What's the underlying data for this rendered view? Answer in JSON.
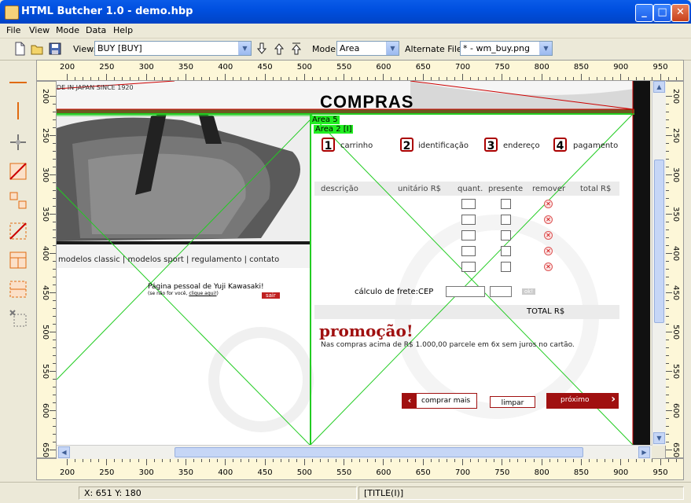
{
  "window": {
    "title": "HTML Butcher 1.0 - demo.hbp"
  },
  "menu": [
    "File",
    "View",
    "Mode",
    "Data",
    "Help"
  ],
  "toolbar": {
    "view_label": "View:",
    "view_value": "BUY [BUY]",
    "mode_label": "Mode:",
    "mode_value": "Area",
    "alt_label": "Alternate File:",
    "alt_value": "* - wm_buy.png"
  },
  "ruler_h_labels": [
    "200",
    "250",
    "300",
    "350",
    "400",
    "450",
    "500",
    "550",
    "600",
    "650",
    "700",
    "750",
    "800",
    "850",
    "900",
    "950"
  ],
  "ruler_v_labels": [
    "200",
    "250",
    "300",
    "350",
    "400",
    "450",
    "500",
    "550",
    "600",
    "650"
  ],
  "page": {
    "made_in": "DE IN JAPAN SINCE 1920",
    "heading": "COMPRAS",
    "area5": "Area 5",
    "area2": "Area 2 [I]",
    "steps": [
      {
        "num": "1",
        "label": "carrinho"
      },
      {
        "num": "2",
        "label": "identificação"
      },
      {
        "num": "3",
        "label": "endereço"
      },
      {
        "num": "4",
        "label": "pagamento"
      }
    ],
    "table_headers": [
      "descrição",
      "unitário R$",
      "quant.",
      "presente",
      "remover",
      "total R$"
    ],
    "nav": "modelos classic | modelos sport | regulamento | contato",
    "greeting": "Página pessoal de Yuji Kawasaki!",
    "not_you_prefix": "(se não for você, ",
    "not_you_link": "clique aqui!",
    "not_you_suffix": ")",
    "logout": "sair",
    "freight_label": "cálculo de frete:CEP",
    "ok": "ok!",
    "total_label": "TOTAL R$",
    "promo_title": "promoção!",
    "promo_text": "Nas compras acima de R$ 1.000,00 parcele em 6x sem juros no cartão.",
    "btn_more": "comprar mais",
    "btn_clear": "limpar",
    "btn_next": "próximo"
  },
  "status": {
    "coords": "X: 651 Y: 180",
    "tag": "[TITLE(I)]"
  },
  "colors": {
    "titlebar": "#0050e0",
    "accent_red": "#a01010",
    "area_green": "#22cc22"
  }
}
